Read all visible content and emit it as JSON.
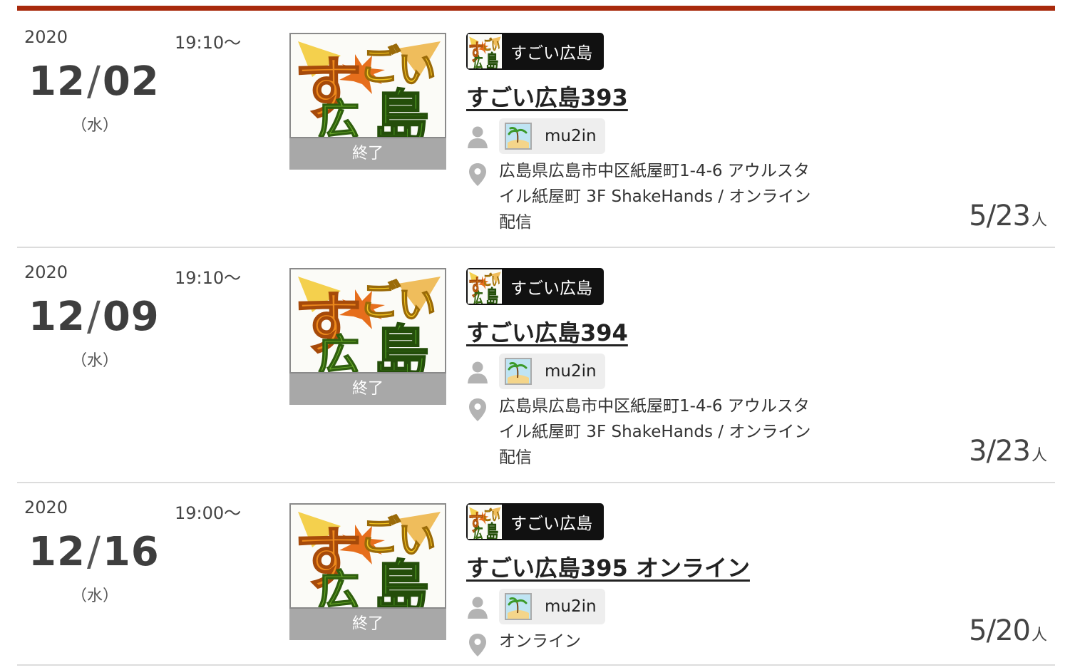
{
  "events": [
    {
      "year": "2020",
      "month": "12",
      "day": "02",
      "weekday": "（水）",
      "time": "19:10〜",
      "status": "終了",
      "group_name": "すごい広島",
      "title": "すごい広島393",
      "owner": "mu2in",
      "venue": "広島県広島市中区紙屋町1-4-6 アウルスタイル紙屋町 3F ShakeHands / オンライン配信",
      "attendance": "5/23",
      "unit": "人"
    },
    {
      "year": "2020",
      "month": "12",
      "day": "09",
      "weekday": "（水）",
      "time": "19:10〜",
      "status": "終了",
      "group_name": "すごい広島",
      "title": "すごい広島394",
      "owner": "mu2in",
      "venue": "広島県広島市中区紙屋町1-4-6 アウルスタイル紙屋町 3F ShakeHands / オンライン配信",
      "attendance": "3/23",
      "unit": "人"
    },
    {
      "year": "2020",
      "month": "12",
      "day": "16",
      "weekday": "（水）",
      "time": "19:00〜",
      "status": "終了",
      "group_name": "すごい広島",
      "title": "すごい広島395 オンライン",
      "owner": "mu2in",
      "venue": "オンライン",
      "attendance": "5/20",
      "unit": "人"
    }
  ],
  "colors": {
    "accent_bar": "#a82a0c",
    "status_bg": "#a8a8a8",
    "group_badge_bg": "#111111"
  },
  "icons": {
    "owner": "user-icon",
    "venue": "map-pin-icon",
    "avatar": "island-avatar-icon"
  }
}
